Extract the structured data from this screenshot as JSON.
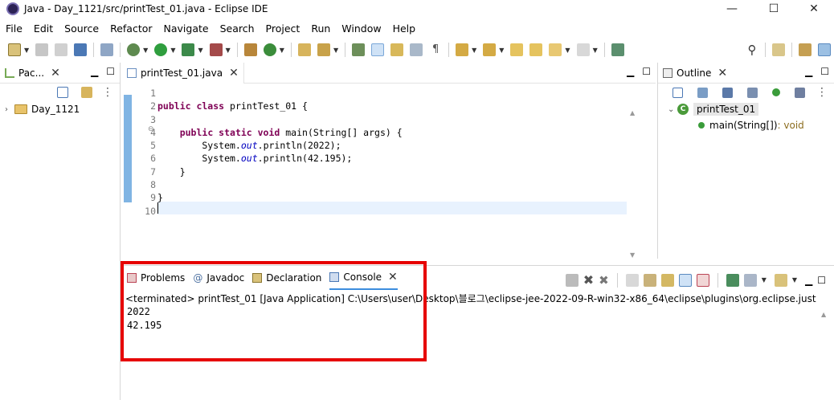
{
  "window": {
    "title": "Java - Day_1121/src/printTest_01.java - Eclipse IDE",
    "minimize_glyph": "—",
    "maximize_glyph": "☐",
    "close_glyph": "✕"
  },
  "menu": [
    "File",
    "Edit",
    "Source",
    "Refactor",
    "Navigate",
    "Search",
    "Project",
    "Run",
    "Window",
    "Help"
  ],
  "package_explorer": {
    "tab_label": "Pac...",
    "close_glyph": "✕",
    "project": "Day_1121"
  },
  "editor": {
    "tab_label": "printTest_01.java",
    "close_glyph": "✕",
    "line_numbers": [
      "1",
      "2",
      "3",
      "4",
      "5",
      "6",
      "7",
      "8",
      "9",
      "10"
    ]
  },
  "outline": {
    "tab_label": "Outline",
    "close_glyph": "✕",
    "class_name": "printTest_01",
    "method_name": "main(String[])",
    "method_return": " : void"
  },
  "console": {
    "tabs": [
      {
        "label": "Problems",
        "icon": "problems-icon"
      },
      {
        "label": "Javadoc",
        "icon": "at-icon"
      },
      {
        "label": "Declaration",
        "icon": "declaration-icon"
      },
      {
        "label": "Console",
        "icon": "console-icon"
      }
    ],
    "close_glyph": "✕",
    "terminated_line": "<terminated> printTest_01 [Java Application] C:\\Users\\user\\Desktop\\블로그\\eclipse-jee-2022-09-R-win32-x86_64\\eclipse\\plugins\\org.eclipse.just",
    "output": [
      "2022",
      "42.195"
    ]
  },
  "colors": {
    "keyword": "#7f0055",
    "field": "#0000c0",
    "highlight_border": "#e60000",
    "change_marker": "#80b4e3"
  }
}
